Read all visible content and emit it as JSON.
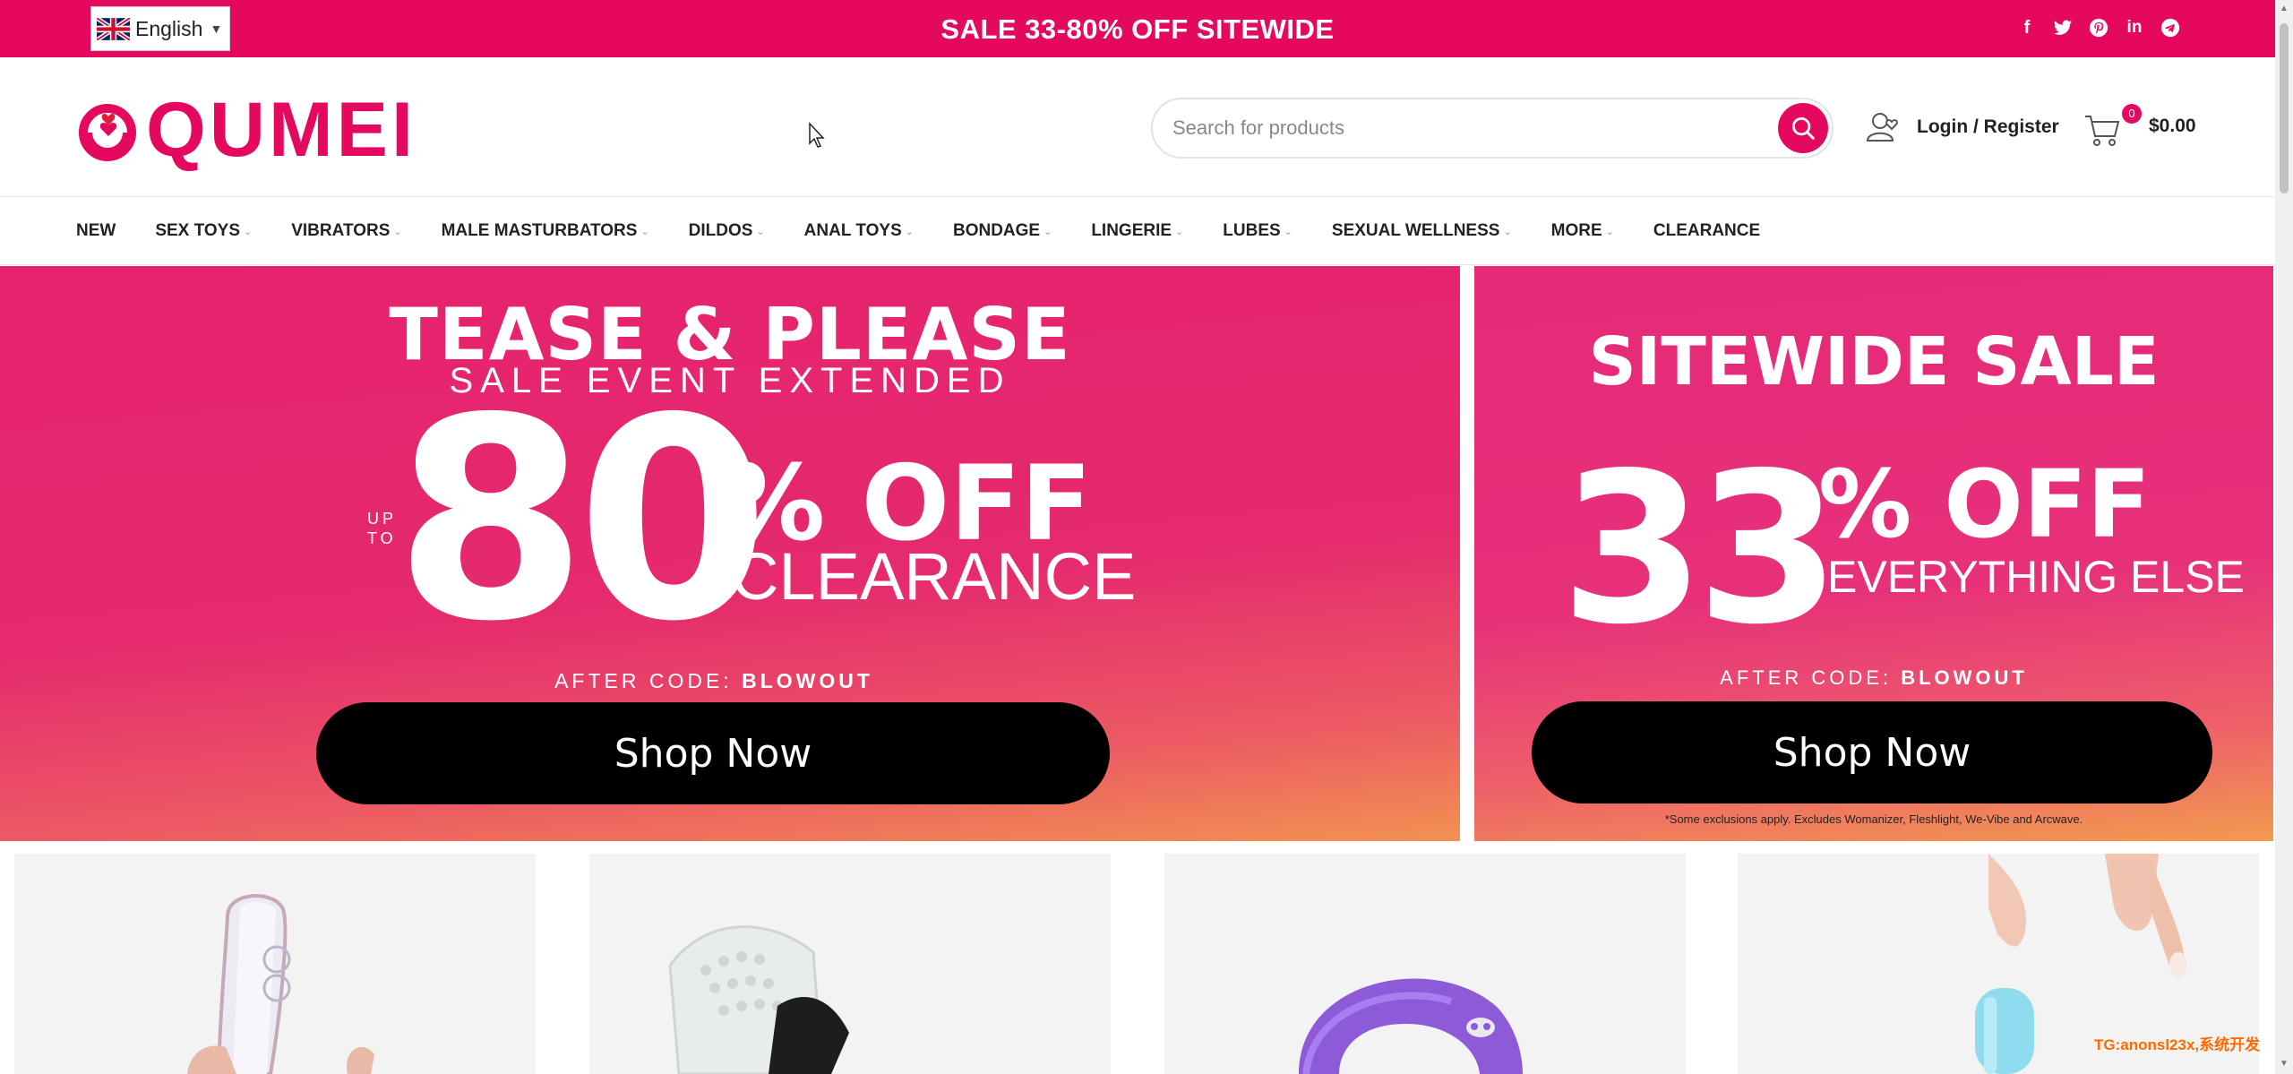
{
  "topbar": {
    "language": "English",
    "promo": "SALE 33-80% OFF SITEWIDE",
    "social_icons": [
      "facebook-icon",
      "twitter-icon",
      "pinterest-icon",
      "linkedin-icon",
      "telegram-icon"
    ]
  },
  "header": {
    "logo_text": "QUMEI",
    "search_placeholder": "Search for products",
    "account_label": "Login / Register",
    "cart_count": "0",
    "cart_total": "$0.00"
  },
  "nav": {
    "items": [
      {
        "label": "NEW",
        "has_dropdown": false
      },
      {
        "label": "SEX TOYS",
        "has_dropdown": true
      },
      {
        "label": "VIBRATORS",
        "has_dropdown": true
      },
      {
        "label": "MALE MASTURBATORS",
        "has_dropdown": true
      },
      {
        "label": "DILDOS",
        "has_dropdown": true
      },
      {
        "label": "ANAL TOYS",
        "has_dropdown": true
      },
      {
        "label": "BONDAGE",
        "has_dropdown": true
      },
      {
        "label": "LINGERIE",
        "has_dropdown": true
      },
      {
        "label": "LUBES",
        "has_dropdown": true
      },
      {
        "label": "SEXUAL WELLNESS",
        "has_dropdown": true
      },
      {
        "label": "MORE",
        "has_dropdown": true
      },
      {
        "label": "CLEARANCE",
        "has_dropdown": false
      }
    ]
  },
  "banner_left": {
    "headline": "TEASE & PLEASE",
    "subheadline": "SALE EVENT EXTENDED",
    "up": "UP",
    "to": "TO",
    "big_number": "80",
    "percent_off": "% OFF",
    "category": "CLEARANCE",
    "code_prefix": "AFTER CODE:",
    "code": "BLOWOUT",
    "button": "Shop Now"
  },
  "banner_right": {
    "headline": "SITEWIDE SALE",
    "big_number": "33",
    "percent_off": "% OFF",
    "category": "EVERYTHING ELSE",
    "code_prefix": "AFTER CODE:",
    "code": "BLOWOUT",
    "button": "Shop Now",
    "disclaimer": "*Some exclusions apply. Excludes Womanizer, Fleshlight, We-Vibe and Arcwave."
  },
  "watermark": "TG:anonsl23x,系统开发",
  "colors": {
    "brand": "#e5085f",
    "purple": "#8d5bd8",
    "light_blue": "#8fdcef"
  }
}
